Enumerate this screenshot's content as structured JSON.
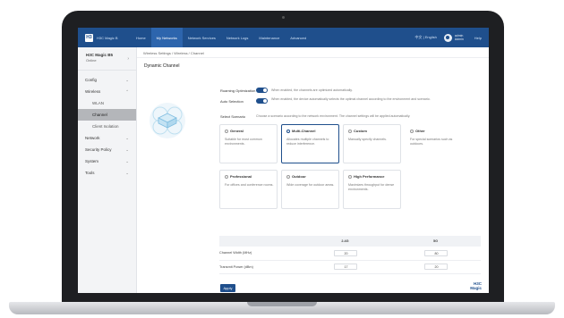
{
  "app": {
    "logo_text": "H3",
    "name": "H3C Magic B",
    "lang": "中文 | English",
    "user_name": "admin",
    "user_role": "Admin",
    "help": "Help"
  },
  "topnav": {
    "tabs": [
      "Home",
      "My Networks",
      "Network Services",
      "Network Logs",
      "Maintenance",
      "Advanced"
    ],
    "active_index": 1
  },
  "sidebar": {
    "device_line1": "H3C Magic B5",
    "device_line2": "Online",
    "items": [
      {
        "label": "Config",
        "type": "group"
      },
      {
        "label": "Wireless",
        "type": "group"
      },
      {
        "label": "WLAN",
        "type": "sub"
      },
      {
        "label": "Channel",
        "type": "sub",
        "active": true
      },
      {
        "label": "Client Isolation",
        "type": "sub"
      },
      {
        "label": "Network",
        "type": "group"
      },
      {
        "label": "Security Policy",
        "type": "group"
      },
      {
        "label": "System",
        "type": "group"
      },
      {
        "label": "Tools",
        "type": "group"
      }
    ]
  },
  "breadcrumb": "Wireless Settings / Wireless / Channel",
  "page_title": "Dynamic Channel",
  "settings": {
    "row1_label": "Roaming Optimization",
    "row1_desc": "When enabled, the channels are optimized automatically.",
    "row2_label": "Auto Selection",
    "row2_desc": "When enabled, the device automatically selects the optimal channel according to the environment and scenario.",
    "row3_label": "Select Scenario",
    "row3_desc": "Choose a scenario according to the network environment. The channel settings will be applied automatically."
  },
  "cards": [
    {
      "title": "General",
      "desc": "Suitable for most common environments.",
      "selected": false,
      "has_border": true
    },
    {
      "title": "Multi-Channel",
      "desc": "Allocates multiple channels to reduce interference.",
      "selected": true,
      "has_border": true
    },
    {
      "title": "Custom",
      "desc": "Manually specify channels.",
      "selected": false,
      "has_border": true
    },
    {
      "title": "Other",
      "desc": "For special scenarios such as outdoors.",
      "selected": false,
      "has_border": false
    },
    {
      "title": "Professional",
      "desc": "For offices and conference rooms.",
      "selected": false,
      "has_border": true
    },
    {
      "title": "Outdoor",
      "desc": "Wide coverage for outdoor areas.",
      "selected": false,
      "has_border": true
    },
    {
      "title": "High Performance",
      "desc": "Maximizes throughput for dense environments.",
      "selected": false,
      "has_border": true
    }
  ],
  "table": {
    "headers": [
      "",
      "2.4G",
      "5G"
    ],
    "rows": [
      {
        "label": "Channel Width (MHz)",
        "v24": "20",
        "v5": "80"
      },
      {
        "label": "Transmit Power (dBm)",
        "v24": "17",
        "v5": "20"
      }
    ]
  },
  "apply_label": "Apply",
  "brand": {
    "line1": "H3C",
    "line2": "Magic"
  }
}
